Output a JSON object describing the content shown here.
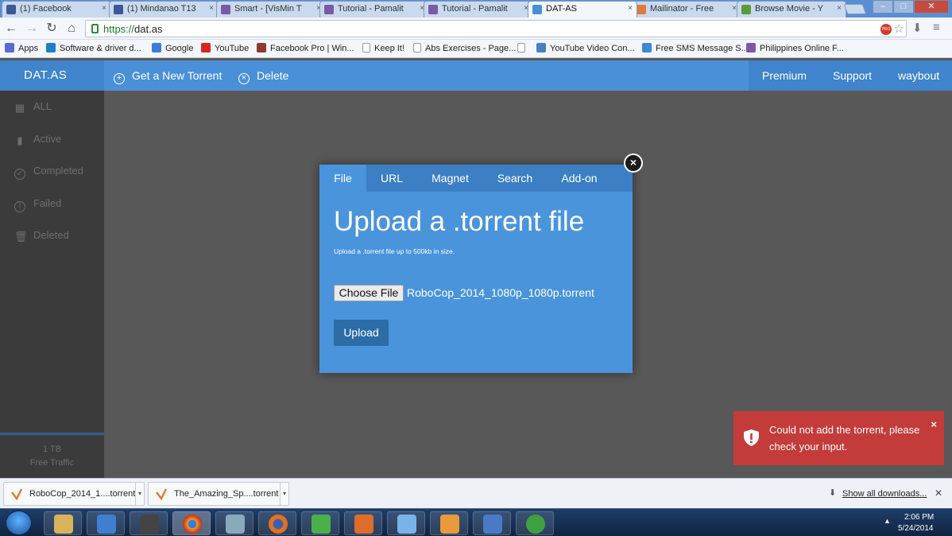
{
  "browser": {
    "tabs": [
      {
        "label": "(1) Facebook",
        "fav_color": "#3b5998"
      },
      {
        "label": "(1) Mindanao T13",
        "fav_color": "#3b5998"
      },
      {
        "label": "Smart - [VisMin T",
        "fav_color": "#7a5aa6"
      },
      {
        "label": "Tutorial - Pamalit",
        "fav_color": "#7a5aa6"
      },
      {
        "label": "Tutorial - Pamalit",
        "fav_color": "#7a5aa6"
      },
      {
        "label": "DAT-AS",
        "fav_color": "#4a90d9"
      },
      {
        "label": "Mailinator - Free",
        "fav_color": "#e07b39"
      },
      {
        "label": "Browse Movie - Y",
        "fav_color": "#5c9a3a"
      }
    ],
    "url_scheme": "https://",
    "url_domain": "dat.as",
    "pro_badge": "PRO",
    "bookmarks": [
      {
        "label": "Apps",
        "icon": "apps-grid-icon",
        "color": "#5b6bd6"
      },
      {
        "label": "Software & driver d...",
        "icon": "hp-icon",
        "color": "#1e7fc9"
      },
      {
        "label": "Google",
        "icon": "google-icon",
        "color": "#3b7cd8"
      },
      {
        "label": "YouTube",
        "icon": "youtube-icon",
        "color": "#d9261c"
      },
      {
        "label": "Facebook Pro | Win...",
        "icon": "grid-icon",
        "color": "#8e3b2e"
      },
      {
        "label": "Keep It!",
        "icon": "page-icon",
        "color": "#cccccc"
      },
      {
        "label": "Abs Exercises - Page...",
        "icon": "page-icon",
        "color": "#cccccc"
      },
      {
        "label": "",
        "icon": "page-icon",
        "color": "#cccccc"
      },
      {
        "label": "YouTube Video Con...",
        "icon": "converter-icon",
        "color": "#4a7fc4"
      },
      {
        "label": "Free SMS Message S...",
        "icon": "phone-icon",
        "color": "#3a8ad4"
      },
      {
        "label": "Philippines Online F...",
        "icon": "shield-fav-icon",
        "color": "#7a5aa6"
      }
    ]
  },
  "site": {
    "brand": "DAT.AS",
    "nav": {
      "new_torrent": "Get a New Torrent",
      "delete": "Delete",
      "premium": "Premium",
      "support": "Support",
      "user": "waybout"
    },
    "sidebar": [
      {
        "label": "ALL",
        "icon": "grid-icon",
        "glyph": "▦"
      },
      {
        "label": "Active",
        "icon": "bar-chart-icon",
        "glyph": "▮"
      },
      {
        "label": "Completed",
        "icon": "check-circle-icon",
        "glyph": "✓"
      },
      {
        "label": "Failed",
        "icon": "alert-circle-icon",
        "glyph": "!"
      },
      {
        "label": "Deleted",
        "icon": "trash-icon",
        "glyph": "🗑"
      }
    ],
    "traffic_amount": "1 TB",
    "traffic_label": "Free Traffic"
  },
  "modal": {
    "tabs": [
      "File",
      "URL",
      "Magnet",
      "Search",
      "Add-on"
    ],
    "active_tab": "File",
    "title": "Upload a .torrent file",
    "subtitle": "Upload a .torrent file up to 500kb in size.",
    "choose_label": "Choose File",
    "file_name": "RoboCop_2014_1080p_1080p.torrent",
    "upload_label": "Upload"
  },
  "toast": {
    "message": "Could not add the torrent, please check your input.",
    "color": "#c33c3a"
  },
  "downloads": {
    "items": [
      "RoboCop_2014_1....torrent",
      "The_Amazing_Sp....torrent"
    ],
    "show_all": "Show all downloads..."
  },
  "taskbar": {
    "time": "2:06 PM",
    "date": "5/24/2014"
  }
}
